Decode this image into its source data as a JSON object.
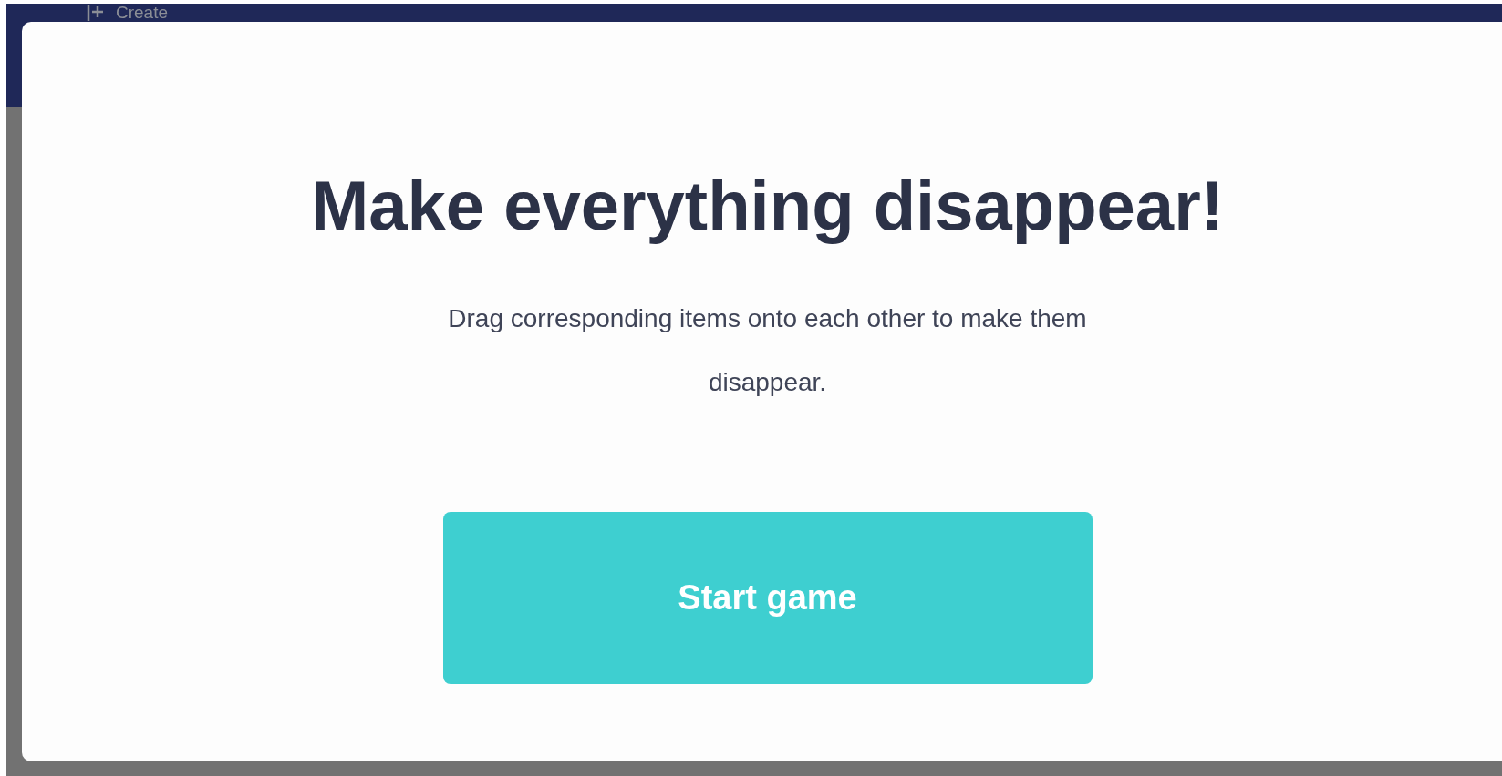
{
  "navbar": {
    "create_label": "Create"
  },
  "dialog": {
    "title": "Make everything disappear!",
    "message": "Drag corresponding items onto each other to make them disappear.",
    "button": "Start game"
  }
}
